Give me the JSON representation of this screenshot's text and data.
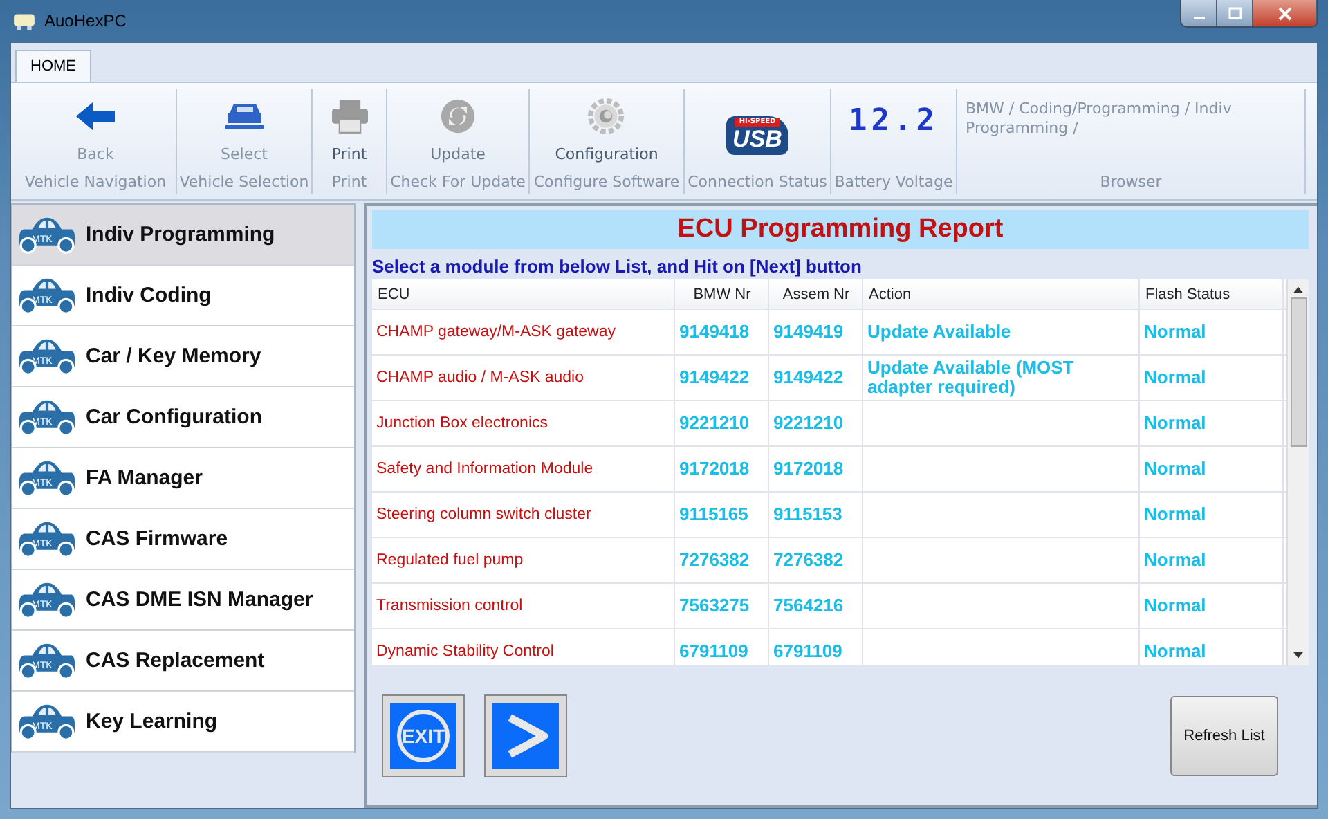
{
  "window": {
    "title": "AuoHexPC"
  },
  "tabs": [
    {
      "label": "HOME",
      "selected": true
    }
  ],
  "ribbon": {
    "groups": [
      {
        "kind": "back",
        "button": "Back",
        "caption": "Vehicle Navigation"
      },
      {
        "kind": "car",
        "button": "Select",
        "caption": "Vehicle Selection"
      },
      {
        "kind": "print",
        "button": "Print",
        "caption": "Print"
      },
      {
        "kind": "update",
        "button": "Update",
        "caption": "Check For Update"
      },
      {
        "kind": "gear",
        "button": "Configuration",
        "caption": "Configure Software"
      },
      {
        "kind": "usb",
        "logo_top": "HI-SPEED",
        "logo": "USB",
        "caption": "Connection Status"
      },
      {
        "kind": "voltage",
        "reading": "12.2",
        "caption": "Battery Voltage"
      },
      {
        "kind": "browser",
        "path": "BMW / Coding/Programming / Indiv Programming /",
        "caption": "Browser"
      }
    ]
  },
  "sidebar": {
    "items": [
      {
        "label": "Indiv Programming",
        "badge": "MTK",
        "selected": true
      },
      {
        "label": "Indiv Coding",
        "badge": "MTK",
        "selected": false
      },
      {
        "label": "Car / Key Memory",
        "badge": "MTK",
        "selected": false
      },
      {
        "label": "Car Configuration",
        "badge": "MTK",
        "selected": false
      },
      {
        "label": "FA Manager",
        "badge": "MTK",
        "selected": false
      },
      {
        "label": "CAS Firmware",
        "badge": "MTK",
        "selected": false
      },
      {
        "label": "CAS DME ISN Manager",
        "badge": "MTK",
        "selected": false
      },
      {
        "label": "CAS Replacement",
        "badge": "MTK",
        "selected": false
      },
      {
        "label": "Key Learning",
        "badge": "MTK",
        "selected": false
      }
    ]
  },
  "report": {
    "title": "ECU Programming Report",
    "instruction": "Select a module from below List, and Hit on [Next] button"
  },
  "table": {
    "columns": [
      "ECU",
      "BMW Nr",
      "Assem Nr",
      "Action",
      "Flash Status"
    ],
    "rows": [
      [
        "CHAMP gateway/M-ASK gateway",
        "9149418",
        "9149419",
        "Update Available",
        "Normal"
      ],
      [
        "CHAMP audio / M-ASK audio",
        "9149422",
        "9149422",
        "Update Available (MOST adapter required)",
        "Normal"
      ],
      [
        "Junction Box electronics",
        "9221210",
        "9221210",
        "",
        "Normal"
      ],
      [
        "Safety and Information Module",
        "9172018",
        "9172018",
        "",
        "Normal"
      ],
      [
        "Steering column switch cluster",
        "9115165",
        "9115153",
        "",
        "Normal"
      ],
      [
        "Regulated fuel pump",
        "7276382",
        "7276382",
        "",
        "Normal"
      ],
      [
        "Transmission control",
        "7563275",
        "7564216",
        "",
        "Normal"
      ],
      [
        "Dynamic Stability Control",
        "6791109",
        "6791109",
        "",
        "Normal"
      ]
    ]
  },
  "buttons": {
    "exit": "EXIT",
    "refresh": "Refresh List"
  }
}
